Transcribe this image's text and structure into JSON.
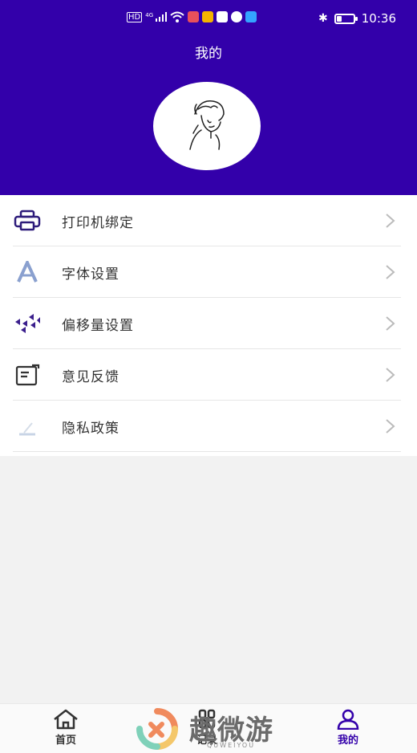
{
  "status_bar": {
    "left_icons": [
      "hd-icon",
      "signal-4g-icon",
      "wifi-icon",
      "app-red-icon",
      "weibo-icon",
      "app-blue-icon",
      "chat-bubble-icon",
      "qq-icon"
    ],
    "network": "4G",
    "time": "10:36",
    "battery_level": 0.3
  },
  "header": {
    "title": "我的",
    "bg_color": "#3300aa"
  },
  "menu": {
    "items": [
      {
        "label": "打印机绑定",
        "icon": "printer-icon"
      },
      {
        "label": "字体设置",
        "icon": "font-icon"
      },
      {
        "label": "偏移量设置",
        "icon": "offset-icon"
      },
      {
        "label": "意见反馈",
        "icon": "feedback-icon"
      },
      {
        "label": "隐私政策",
        "icon": "privacy-icon"
      }
    ]
  },
  "tabbar": {
    "tabs": [
      {
        "label": "首页",
        "icon": "home-icon",
        "active": false
      },
      {
        "label": "记录",
        "icon": "records-icon",
        "active": false
      },
      {
        "label": "我的",
        "icon": "profile-icon",
        "active": true
      }
    ],
    "accent": "#3300aa"
  },
  "watermark": {
    "text": "趣微游",
    "sub": "QUWEIYOU"
  }
}
